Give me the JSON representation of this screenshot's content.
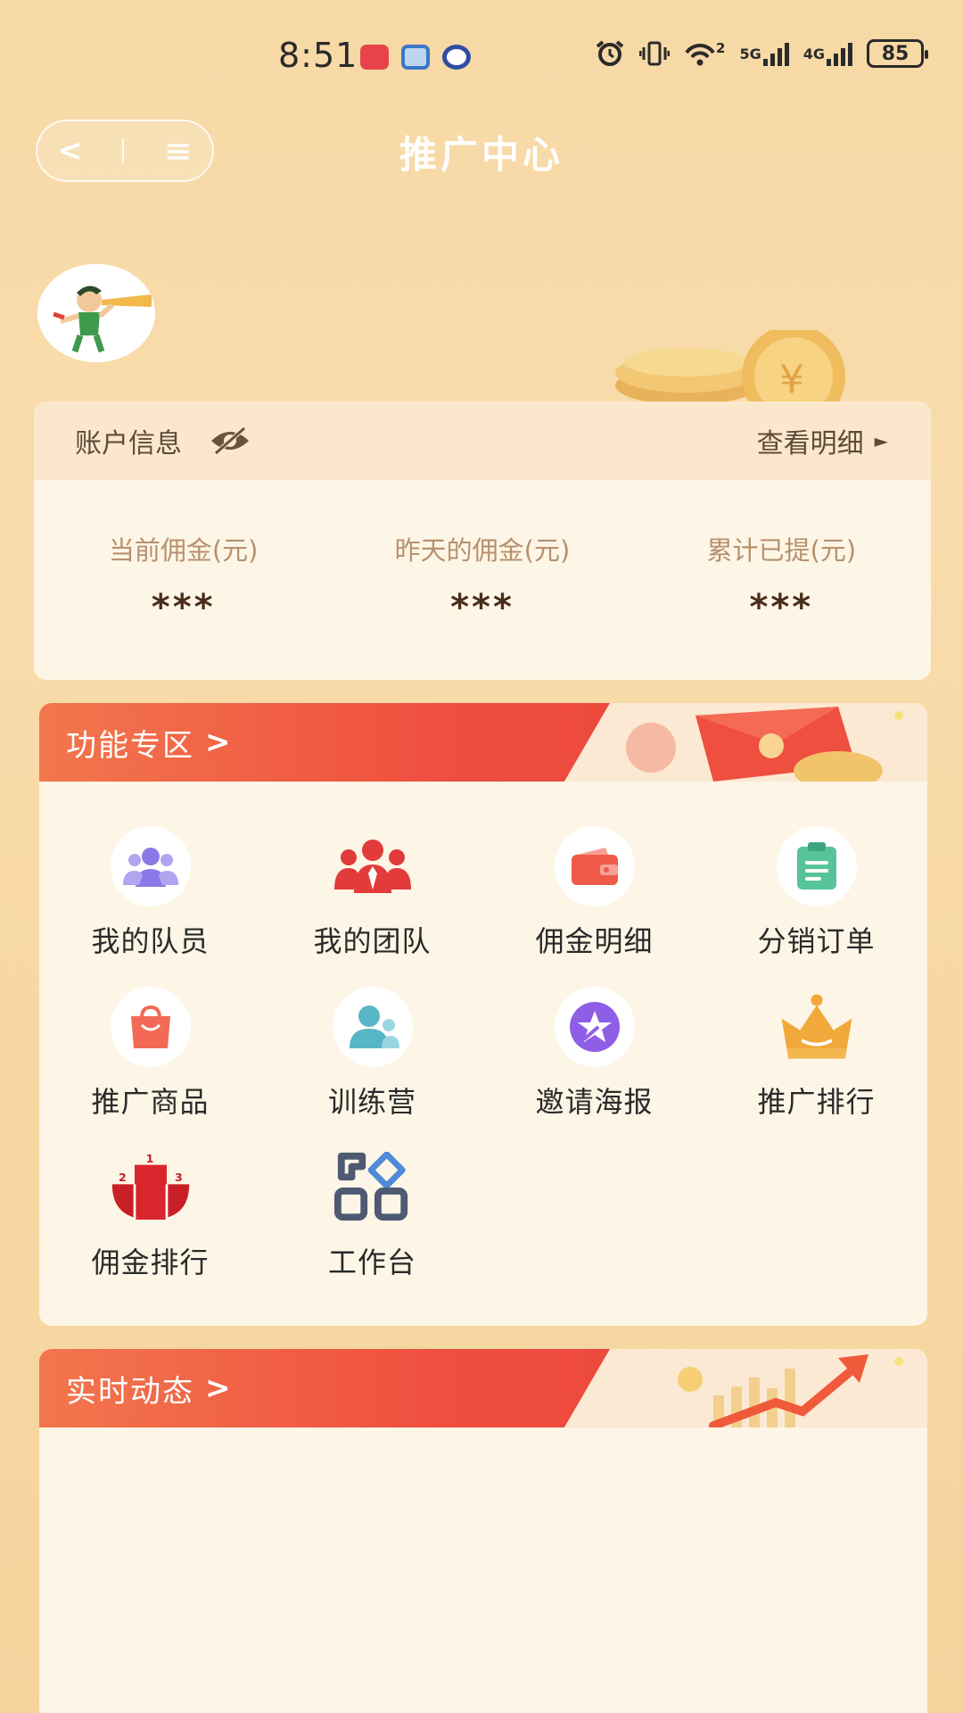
{
  "status_bar": {
    "time": "8:51",
    "network_5g": "5G",
    "network_4g": "4G",
    "battery": "85",
    "wifi_badge": "2"
  },
  "nav": {
    "title": "推广中心",
    "back_symbol": "<",
    "menu_symbol": "≡"
  },
  "account": {
    "header_label": "账户信息",
    "view_detail_label": "查看明细",
    "view_detail_arrow": "►",
    "stats": [
      {
        "label": "当前佣金(元)",
        "value": "***"
      },
      {
        "label": "昨天的佣金(元)",
        "value": "***"
      },
      {
        "label": "累计已提(元)",
        "value": "***"
      }
    ]
  },
  "function_zone": {
    "title": "功能专区",
    "chevron": ">",
    "items": [
      {
        "label": "我的队员",
        "icon": "team-members-icon",
        "color": "#8c78e6"
      },
      {
        "label": "我的团队",
        "icon": "my-team-icon",
        "color": "#e23b3b"
      },
      {
        "label": "佣金明细",
        "icon": "wallet-icon",
        "color": "#ef5a4a"
      },
      {
        "label": "分销订单",
        "icon": "clipboard-icon",
        "color": "#57c39a"
      },
      {
        "label": "推广商品",
        "icon": "shopping-bag-icon",
        "color": "#f26a55"
      },
      {
        "label": "训练营",
        "icon": "trainer-icon",
        "color": "#57b6c6"
      },
      {
        "label": "邀请海报",
        "icon": "star-poster-icon",
        "color": "#8f5ee6"
      },
      {
        "label": "推广排行",
        "icon": "crown-icon",
        "color": "#f0a93a"
      },
      {
        "label": "佣金排行",
        "icon": "podium-icon",
        "color": "#c91f26"
      },
      {
        "label": "工作台",
        "icon": "workbench-icon",
        "color": "#4f5a72"
      }
    ]
  },
  "live_feed": {
    "title": "实时动态",
    "chevron": ">"
  }
}
